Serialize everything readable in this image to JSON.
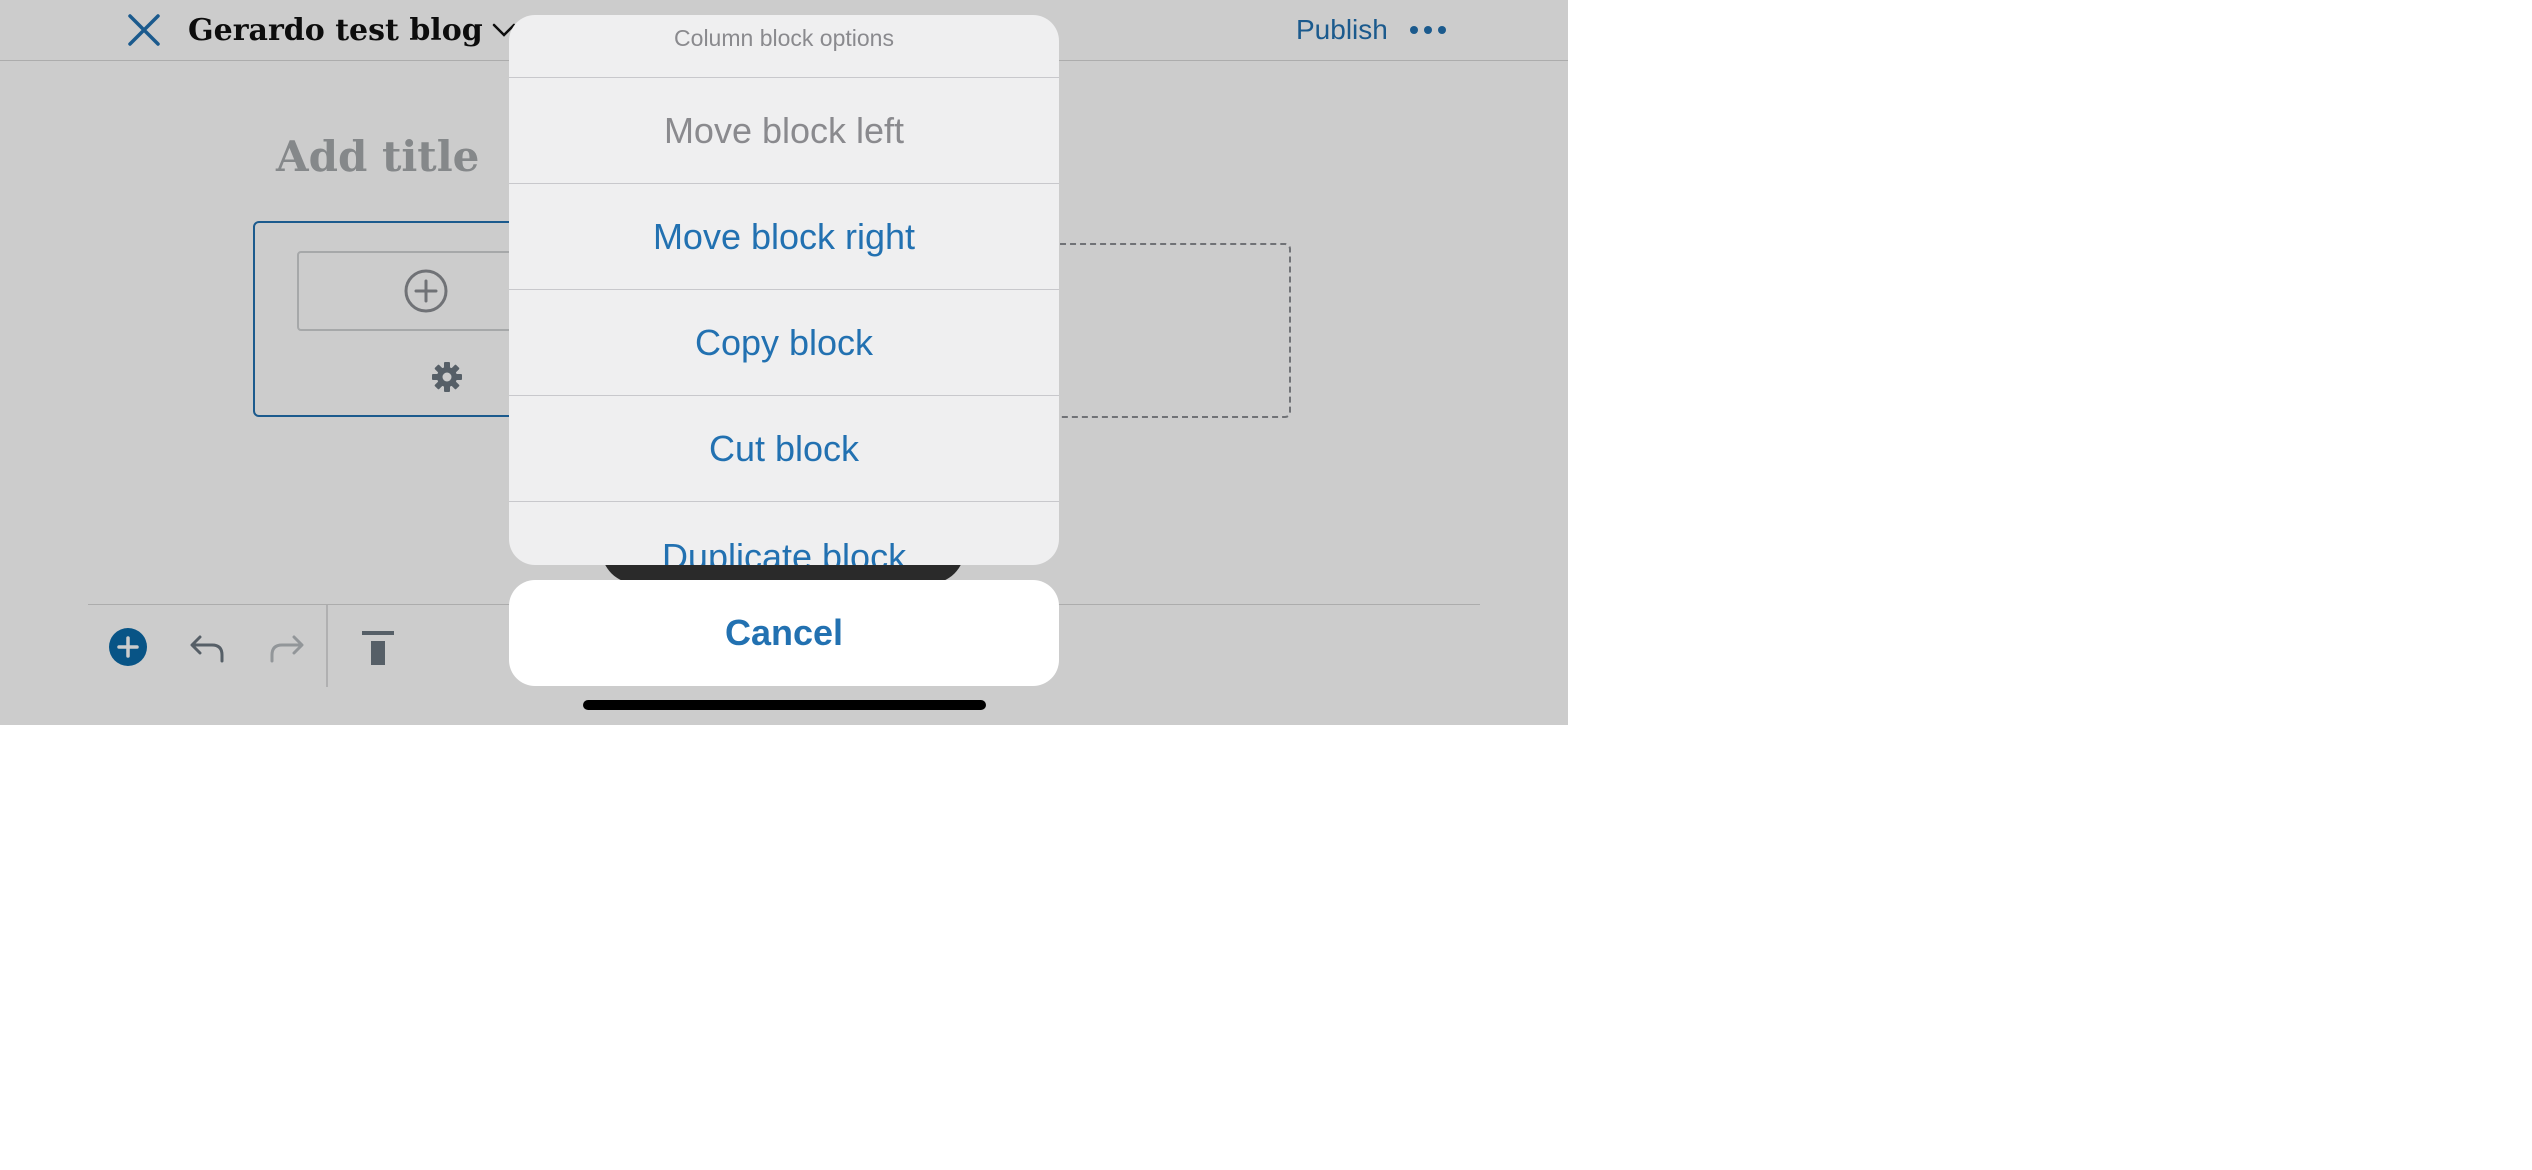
{
  "header": {
    "site_title": "Gerardo test blog",
    "publish_label": "Publish",
    "icons": {
      "close": "close-icon",
      "chevron": "chevron-down-icon",
      "more": "more-horizontal-icon"
    }
  },
  "editor": {
    "title_placeholder": "Add title",
    "icons": {
      "add_block": "plus-circle-icon",
      "settings": "gear-icon"
    }
  },
  "toolbar": {
    "icons": {
      "add": "add-block-icon",
      "undo": "undo-icon",
      "redo": "redo-icon",
      "move_to_top": "move-to-top-icon"
    }
  },
  "action_sheet": {
    "title": "Column block options",
    "items": [
      {
        "label": "Move block left",
        "enabled": false
      },
      {
        "label": "Move block right",
        "enabled": true
      },
      {
        "label": "Copy block",
        "enabled": true
      },
      {
        "label": "Cut block",
        "enabled": true
      },
      {
        "label": "Duplicate block",
        "enabled": true
      }
    ],
    "cancel_label": "Cancel"
  },
  "colors": {
    "accent": "#2271b1",
    "disabled": "#8a8a8e",
    "sheet_bg": "#efeff0"
  }
}
